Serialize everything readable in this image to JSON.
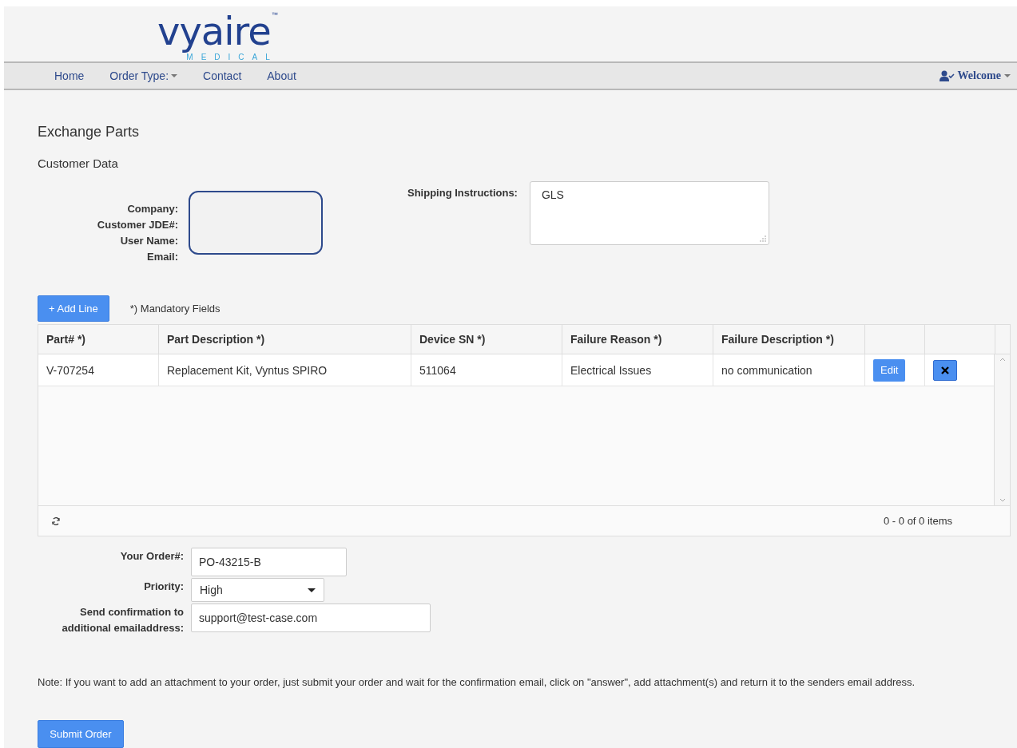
{
  "logo": {
    "name": "vyaire",
    "trademark": "™",
    "tagline": "MEDICAL"
  },
  "nav": {
    "items": [
      {
        "label": "Home",
        "dropdown": false
      },
      {
        "label": "Order Type:",
        "dropdown": true
      },
      {
        "label": "Contact",
        "dropdown": false
      },
      {
        "label": "About",
        "dropdown": false
      }
    ],
    "user_menu": "Welcome"
  },
  "page_title": "Exchange Parts",
  "section_title": "Customer Data",
  "customer_labels": [
    "Company:",
    "Customer JDE#:",
    "User Name:",
    "Email:"
  ],
  "shipping": {
    "label": "Shipping Instructions:",
    "value": "GLS"
  },
  "add_line_button": "+ Add Line",
  "mandatory_note": "*) Mandatory Fields",
  "table": {
    "columns": [
      "Part# *)",
      "Part Description *)",
      "Device SN *)",
      "Failure Reason *)",
      "Failure Description *)"
    ],
    "rows": [
      {
        "cells": [
          "V-707254",
          "Replacement Kit, Vyntus SPIRO",
          "511064",
          "Electrical Issues",
          "no communication"
        ],
        "edit": "Edit"
      }
    ],
    "pager": "0 - 0 of 0 items"
  },
  "form": [
    {
      "kind": "input",
      "label": "Your Order#:",
      "value": "PO-43215-B"
    },
    {
      "kind": "select",
      "label": "Priority:",
      "value": "High"
    },
    {
      "kind": "email",
      "label": "Send confirmation to additional emailaddress:",
      "value": "support@test-case.com"
    }
  ],
  "note": "Note: If you want to add an attachment to your order, just submit your order and wait for the confirmation email, click on \"answer\", add attachment(s) and return it to the senders email address.",
  "submit_button": "Submit Order"
}
